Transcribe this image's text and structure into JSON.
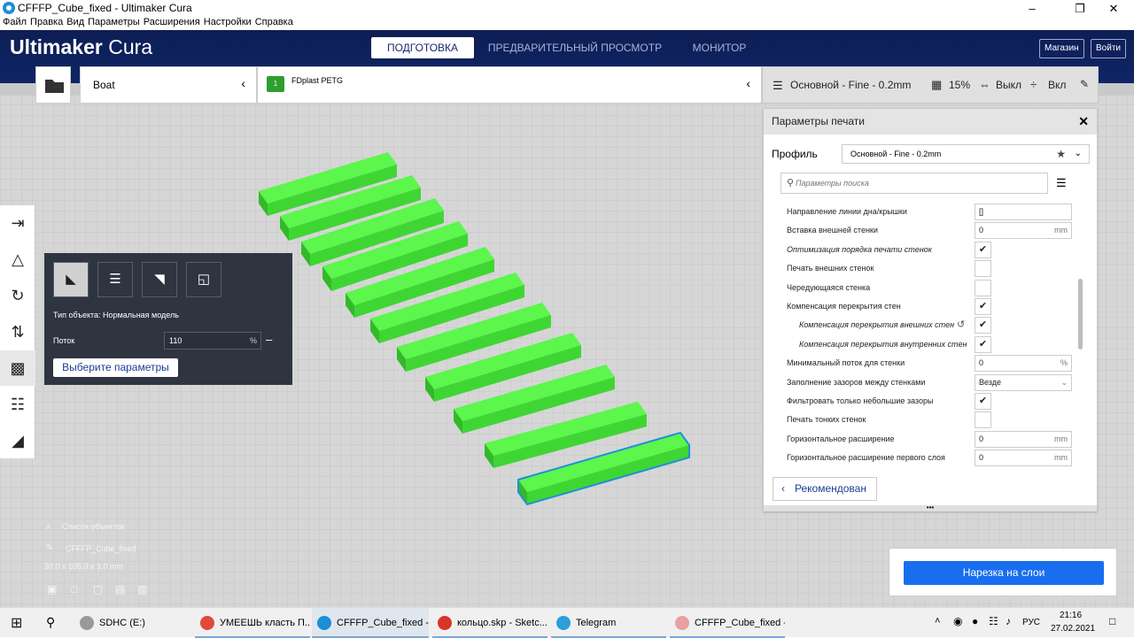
{
  "window": {
    "title": "CFFFP_Cube_fixed - Ultimaker Cura"
  },
  "menu": [
    "Файл",
    "Правка",
    "Вид",
    "Параметры",
    "Расширения",
    "Настройки",
    "Справка"
  ],
  "header": {
    "brand_bold": "Ultimaker",
    "brand_light": "Cura",
    "stages": [
      "ПОДГОТОВКА",
      "ПРЕДВАРИТЕЛЬНЫЙ ПРОСМОТР",
      "МОНИТОР"
    ],
    "store": "Магазин",
    "login": "Войти"
  },
  "stagebar": {
    "printer": "Boat",
    "material": "FDplast PETG"
  },
  "print_setup": {
    "profile": "Основной - Fine - 0.2mm",
    "infill": "15%",
    "support": "Выкл",
    "adhesion": "Вкл"
  },
  "panel": {
    "title": "Параметры печати",
    "profile_label": "Профиль",
    "profile_value": "Основной - Fine - 0.2mm",
    "search_placeholder": "Параметры поиска",
    "recommended": "Рекомендован",
    "settings": [
      {
        "label": "Направление линии дна/крышки",
        "kind": "text",
        "value": "[]"
      },
      {
        "label": "Вставка внешней стенки",
        "kind": "num",
        "value": "0",
        "unit": "mm"
      },
      {
        "label": "Оптимизация порядка печати стенок",
        "kind": "check",
        "value": "✔",
        "italic": true
      },
      {
        "label": "Печать внешних стенок",
        "kind": "check",
        "value": ""
      },
      {
        "label": "Чередующаяся стенка",
        "kind": "check",
        "value": ""
      },
      {
        "label": "Компенсация перекрытия стен",
        "kind": "check",
        "value": "✔"
      },
      {
        "label": "Компенсация перекрытия внешних стен",
        "kind": "check",
        "value": "✔",
        "italic": true,
        "indent": true
      },
      {
        "label": "Компенсация перекрытия внутренних стен",
        "kind": "check",
        "value": "✔",
        "italic": true,
        "indent": true
      },
      {
        "label": "Минимальный поток для стенки",
        "kind": "num",
        "value": "0",
        "unit": "%"
      },
      {
        "label": "Заполнение зазоров между стенками",
        "kind": "select",
        "value": "Везде"
      },
      {
        "label": "Фильтровать только небольшие зазоры",
        "kind": "check",
        "value": "✔"
      },
      {
        "label": "Печать тонких стенок",
        "kind": "check",
        "value": ""
      },
      {
        "label": "Горизонтальное расширение",
        "kind": "num",
        "value": "0",
        "unit": "mm"
      },
      {
        "label": "Горизонтальное расширение первого слоя",
        "kind": "num",
        "value": "0",
        "unit": "mm"
      }
    ]
  },
  "per_model": {
    "object_type": "Тип объекта: Нормальная модель",
    "flow_label": "Поток",
    "flow_value": "110",
    "flow_unit": "%",
    "select_button": "Выберите параметры"
  },
  "object_list": {
    "title": "Список объектов",
    "object": "CFFFP_Cube_fixed",
    "dims": "30.0 x 105.0 x 3.0 mm"
  },
  "slice_button": "Нарезка на слои",
  "taskbar": {
    "items": [
      "SDHC (E:)",
      "УМЕЕШЬ класть П...",
      "CFFFP_Cube_fixed - ...",
      "кольцо.skp - Sketc...",
      "Telegram",
      "CFFFP_Cube_fixed - ..."
    ],
    "lang": "РУС",
    "time": "21:16",
    "date": "27.02.2021"
  },
  "colors": {
    "header": "#0f2566",
    "accent": "#196ef0",
    "model": "#52f542",
    "selected_outline": "#1e90d6"
  }
}
